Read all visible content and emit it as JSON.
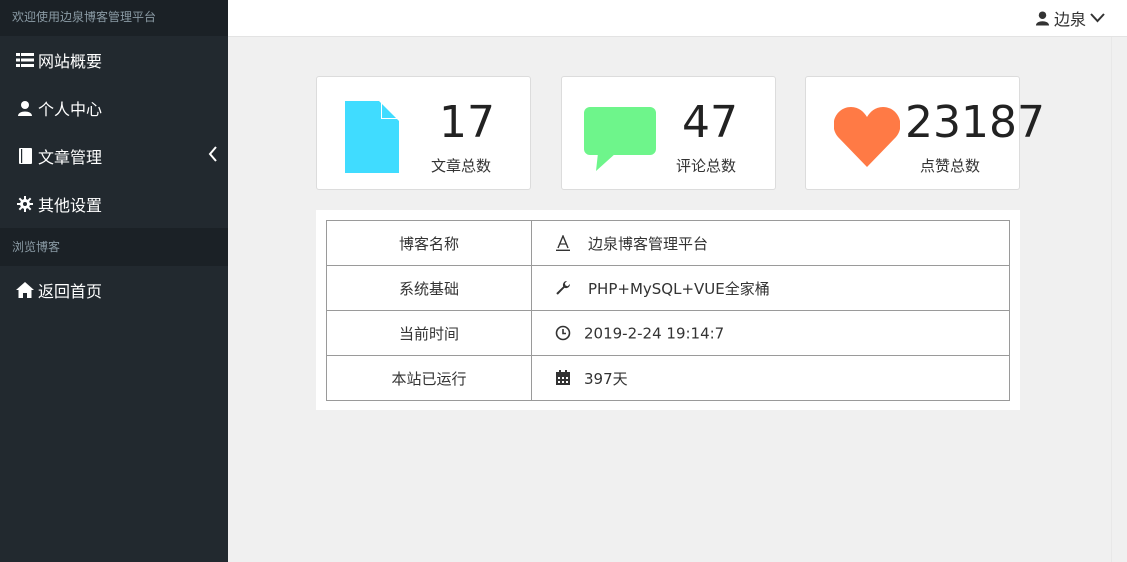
{
  "sidebar": {
    "welcome": "欢迎使用边泉博客管理平台",
    "items": [
      {
        "label": "网站概要",
        "icon": "list-icon"
      },
      {
        "label": "个人中心",
        "icon": "user-icon"
      },
      {
        "label": "文章管理",
        "icon": "book-icon"
      },
      {
        "label": "其他设置",
        "icon": "gear-icon"
      }
    ],
    "section_label": "浏览博客",
    "home": {
      "label": "返回首页",
      "icon": "home-icon"
    }
  },
  "header": {
    "username": "边泉"
  },
  "stats": [
    {
      "value": "17",
      "label": "文章总数",
      "icon": "file-icon",
      "color": "#40dcff"
    },
    {
      "value": "47",
      "label": "评论总数",
      "icon": "comment-icon",
      "color": "#6ef58b"
    },
    {
      "value": "23187",
      "label": "点赞总数",
      "icon": "heart-icon",
      "color": "#ff7a45"
    }
  ],
  "info": [
    {
      "key": "博客名称",
      "value": "边泉博客管理平台",
      "icon": "font-icon"
    },
    {
      "key": "系统基础",
      "value": "PHP+MySQL+VUE全家桶",
      "icon": "wrench-icon"
    },
    {
      "key": "当前时间",
      "value": "2019-2-24 19:14:7",
      "icon": "clock-icon"
    },
    {
      "key": "本站已运行",
      "value": "397天",
      "icon": "calendar-icon"
    }
  ]
}
